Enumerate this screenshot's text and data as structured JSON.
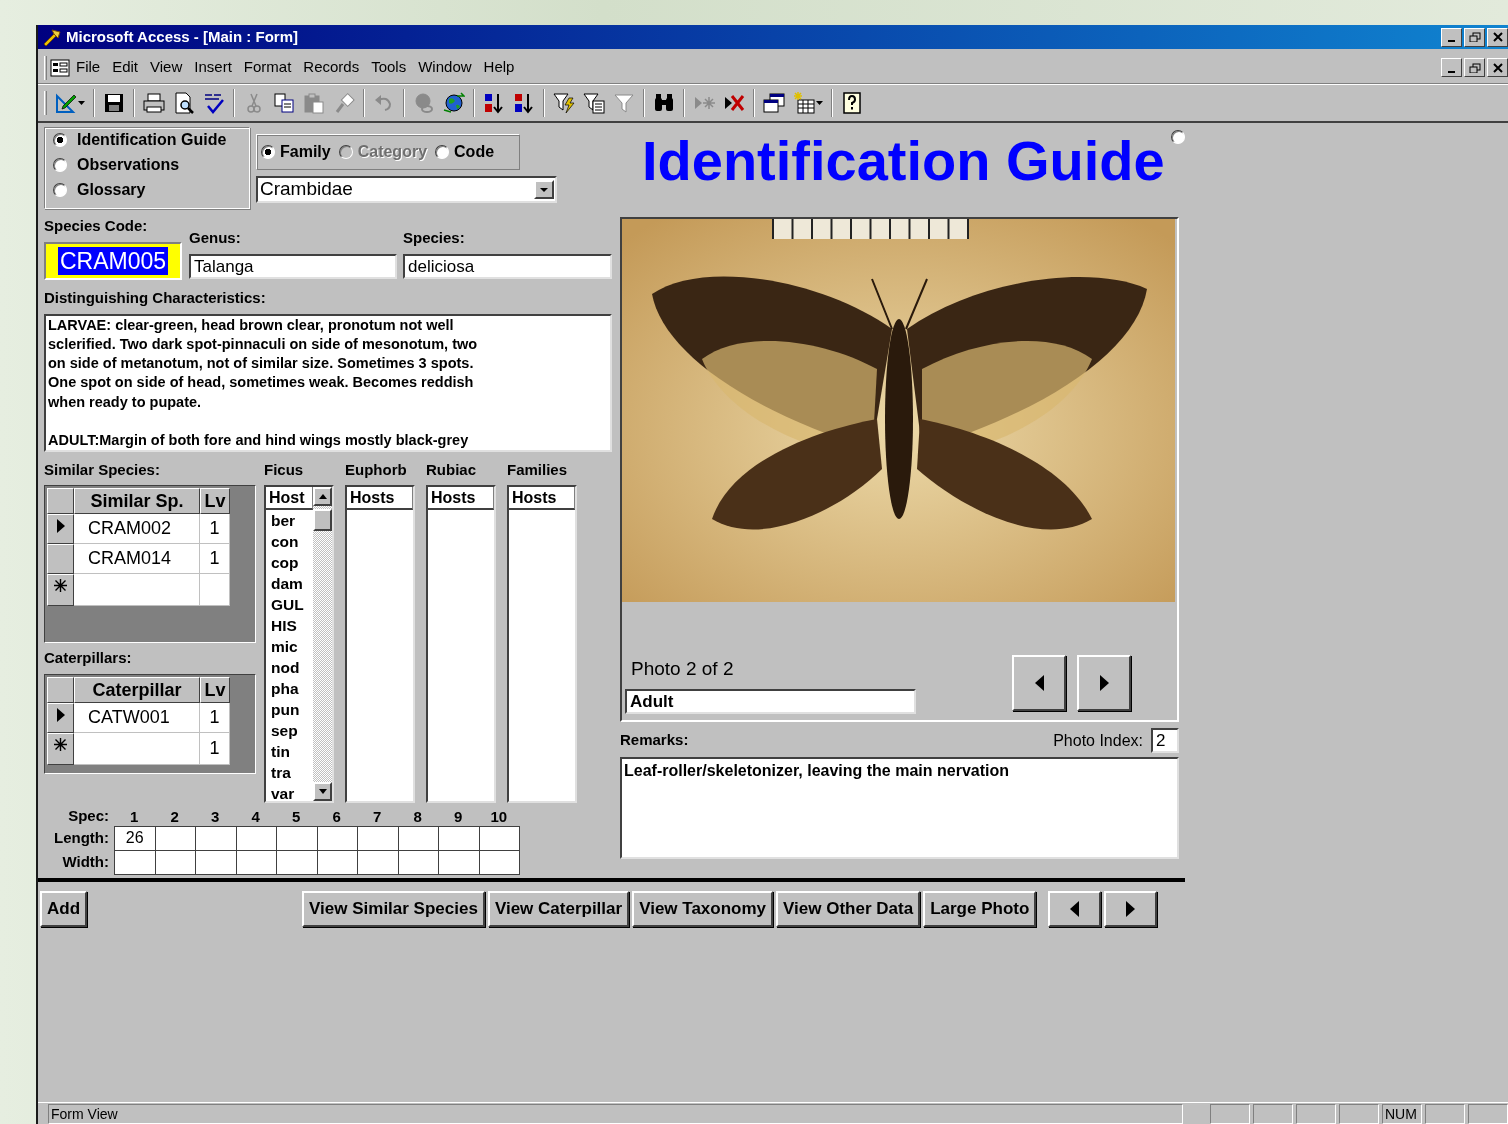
{
  "window": {
    "title": "Microsoft Access - [Main : Form]"
  },
  "menu": [
    "File",
    "Edit",
    "View",
    "Insert",
    "Format",
    "Records",
    "Tools",
    "Window",
    "Help"
  ],
  "toolbar": [
    [
      {
        "kind": "view",
        "disabled": false,
        "dropdown": true
      }
    ],
    [
      {
        "kind": "save",
        "disabled": false,
        "dropdown": false
      }
    ],
    [
      {
        "kind": "print",
        "disabled": false,
        "dropdown": false
      },
      {
        "kind": "preview",
        "disabled": false,
        "dropdown": false
      },
      {
        "kind": "spelling",
        "disabled": false,
        "dropdown": false
      }
    ],
    [
      {
        "kind": "cut",
        "disabled": true,
        "dropdown": false
      },
      {
        "kind": "copy",
        "disabled": false,
        "dropdown": false
      },
      {
        "kind": "paste",
        "disabled": true,
        "dropdown": false
      },
      {
        "kind": "painter",
        "disabled": true,
        "dropdown": false
      }
    ],
    [
      {
        "kind": "undo",
        "disabled": true,
        "dropdown": false
      }
    ],
    [
      {
        "kind": "hyperlink",
        "disabled": true,
        "dropdown": false
      },
      {
        "kind": "web",
        "disabled": false,
        "dropdown": false
      }
    ],
    [
      {
        "kind": "sort_asc",
        "disabled": false,
        "dropdown": false
      },
      {
        "kind": "sort_desc",
        "disabled": false,
        "dropdown": false
      }
    ],
    [
      {
        "kind": "filter_selection",
        "disabled": false,
        "dropdown": false
      },
      {
        "kind": "filter_form",
        "disabled": false,
        "dropdown": false
      },
      {
        "kind": "apply_filter",
        "disabled": true,
        "dropdown": false
      }
    ],
    [
      {
        "kind": "find",
        "disabled": false,
        "dropdown": false
      }
    ],
    [
      {
        "kind": "new_record",
        "disabled": true,
        "dropdown": false
      },
      {
        "kind": "delete_record",
        "disabled": false,
        "dropdown": false
      }
    ],
    [
      {
        "kind": "database",
        "disabled": false,
        "dropdown": false
      },
      {
        "kind": "new_object",
        "disabled": false,
        "dropdown": true
      }
    ],
    [
      {
        "kind": "help",
        "disabled": false,
        "dropdown": false
      }
    ]
  ],
  "form": {
    "mode_options": [
      {
        "label": "Identification Guide",
        "selected": true
      },
      {
        "label": "Observations",
        "selected": false
      },
      {
        "label": "Glossary",
        "selected": false
      }
    ],
    "filter_options": [
      {
        "label": "Family",
        "selected": true,
        "disabled": false
      },
      {
        "label": "Category",
        "selected": false,
        "disabled": true
      },
      {
        "label": "Code",
        "selected": false,
        "disabled": false
      }
    ],
    "family_combo": {
      "value": "Crambidae"
    },
    "heading": "Identification Guide",
    "heading_option": {
      "selected": false
    },
    "species_code": {
      "label": "Species Code:",
      "value": "CRAM005"
    },
    "genus": {
      "label": "Genus:",
      "value": "Talanga"
    },
    "species": {
      "label": "Species:",
      "value": "deliciosa"
    },
    "characteristics": {
      "label": "Distinguishing Characteristics:",
      "value": "LARVAE: clear-green, head brown clear, pronotum not well\nsclerified. Two dark spot-pinnaculi on side of mesonotum, two\non side of metanotum, not of similar size. Sometimes 3 spots.\nOne spot on side of head, sometimes weak. Becomes reddish\nwhen ready to pupate.\n\nADULT:Margin of both fore and hind wings mostly black-grey"
    },
    "similar_species": {
      "label": "Similar Species:",
      "columns": [
        "Similar Sp.",
        "Lv"
      ],
      "rows": [
        {
          "kind": "record",
          "current": true,
          "code": "CRAM002",
          "lv": "1"
        },
        {
          "kind": "record",
          "current": false,
          "code": "CRAM014",
          "lv": "1"
        },
        {
          "kind": "new",
          "current": false
        }
      ]
    },
    "caterpillars": {
      "label": "Caterpillars:",
      "columns": [
        "Caterpillar",
        "Lv"
      ],
      "rows": [
        {
          "kind": "record",
          "current": true,
          "code": "CATW001",
          "lv": "1"
        },
        {
          "kind": "new",
          "current": false,
          "lv": "1"
        }
      ]
    },
    "host_lists": [
      {
        "label": "Ficus",
        "header": "Host",
        "items": [
          "ber",
          "con",
          "cop",
          "dam",
          "GUL",
          "HIS",
          "mic",
          "nod",
          "pha",
          "pun",
          "sep",
          "tin",
          "tra",
          "var"
        ]
      },
      {
        "label": "Euphorb",
        "header": "Hosts"
      },
      {
        "label": "Rubiac",
        "header": "Hosts"
      },
      {
        "label": "Families",
        "header": "Hosts"
      }
    ],
    "measurements": {
      "spec_label": "Spec:",
      "specs": [
        "1",
        "2",
        "3",
        "4",
        "5",
        "6",
        "7",
        "8",
        "9",
        "10"
      ],
      "rows": [
        {
          "label": "Length:",
          "values": [
            "26"
          ]
        },
        {
          "label": "Width:"
        }
      ]
    },
    "photo": {
      "caption": "Photo 2 of 2",
      "stage": "Adult"
    },
    "remarks": {
      "label": "Remarks:",
      "value": "Leaf-roller/skeletonizer, leaving the main nervation"
    },
    "photo_index": {
      "label": "Photo Index:",
      "value": "2"
    },
    "buttons": [
      {
        "kind": "text",
        "label": "Add"
      },
      {
        "kind": "spacer"
      },
      {
        "kind": "text",
        "label": "View Similar Species"
      },
      {
        "kind": "text",
        "label": "View Caterpillar"
      },
      {
        "kind": "text",
        "label": "View Taxonomy"
      },
      {
        "kind": "text",
        "label": "View Other Data"
      },
      {
        "kind": "text",
        "label": "Large Photo"
      },
      {
        "kind": "gap"
      },
      {
        "kind": "previous"
      },
      {
        "kind": "next"
      }
    ]
  },
  "status_bar": {
    "text": "Form View",
    "indicators": [
      {
        "kind": "blank"
      },
      {
        "kind": "blank"
      },
      {
        "kind": "blank"
      },
      {
        "kind": "blank"
      },
      {
        "kind": "text",
        "label": "NUM"
      },
      {
        "kind": "blank"
      },
      {
        "kind": "blank"
      }
    ]
  }
}
